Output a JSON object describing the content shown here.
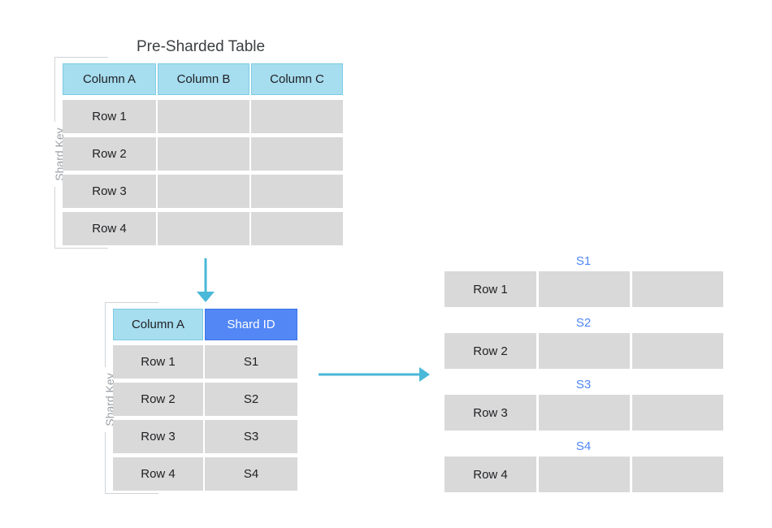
{
  "diagram": {
    "accent_light_blue": "#a6ddef",
    "accent_blue": "#5287f5",
    "cell_gray": "#d9d9d9",
    "arrow_color": "#4ab8d8",
    "shard_label_color": "#4f86f7"
  },
  "source_table": {
    "title": "Pre-Sharded Table",
    "bracket_label": "Shard Key",
    "headers": [
      "Column A",
      "Column B",
      "Column C"
    ],
    "rows": [
      [
        "Row 1",
        "",
        ""
      ],
      [
        "Row 2",
        "",
        ""
      ],
      [
        "Row 3",
        "",
        ""
      ],
      [
        "Row 4",
        "",
        ""
      ]
    ]
  },
  "mapping_table": {
    "bracket_label": "Shard Key",
    "headers": [
      "Column A",
      "Shard ID"
    ],
    "rows": [
      [
        "Row 1",
        "S1"
      ],
      [
        "Row 2",
        "S2"
      ],
      [
        "Row 3",
        "S3"
      ],
      [
        "Row 4",
        "S4"
      ]
    ]
  },
  "shards": [
    {
      "label": "S1",
      "cells": [
        "Row 1",
        "",
        ""
      ]
    },
    {
      "label": "S2",
      "cells": [
        "Row 2",
        "",
        ""
      ]
    },
    {
      "label": "S3",
      "cells": [
        "Row 3",
        "",
        ""
      ]
    },
    {
      "label": "S4",
      "cells": [
        "Row 4",
        "",
        ""
      ]
    }
  ],
  "arrows": {
    "down_arrow_name": "transform-down-arrow",
    "right_arrow_name": "distribute-right-arrow"
  }
}
